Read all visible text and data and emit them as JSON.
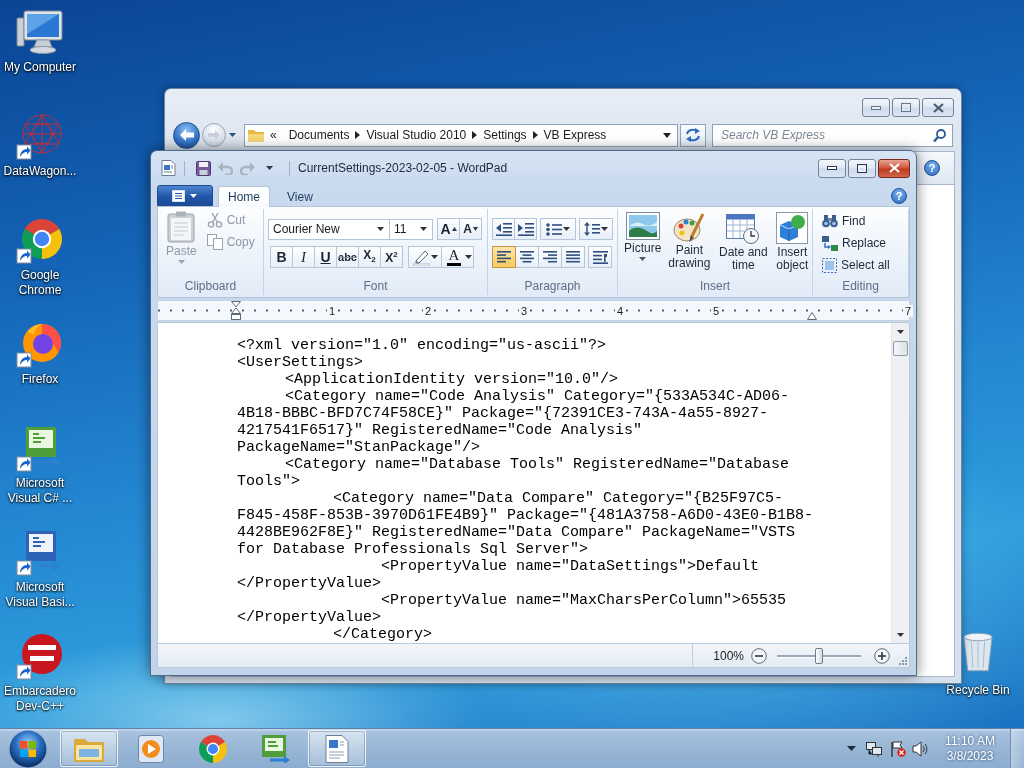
{
  "desktop": {
    "icons": [
      {
        "kind": "computer",
        "label": "My Computer",
        "shortcut": false
      },
      {
        "kind": "network",
        "label": "DataWagon...",
        "shortcut": true
      },
      {
        "kind": "chrome",
        "label": "Google Chrome",
        "shortcut": true
      },
      {
        "kind": "firefox",
        "label": "Firefox",
        "shortcut": true
      },
      {
        "kind": "csharp",
        "label": "Microsoft Visual C# ...",
        "shortcut": true
      },
      {
        "kind": "vb",
        "label": "Microsoft Visual Basi...",
        "shortcut": true
      },
      {
        "kind": "devcpp",
        "label": "Embarcadero Dev-C++",
        "shortcut": true
      }
    ],
    "recycle_bin": {
      "label": "Recycle Bin"
    }
  },
  "explorer": {
    "active": false,
    "nav": [
      {
        "kind": "back",
        "disabled": false
      },
      {
        "kind": "forward",
        "disabled": true
      }
    ],
    "address": {
      "overflow": "«",
      "crumbs": [
        "Documents",
        "Visual Studio 2010",
        "Settings",
        "VB Express"
      ]
    },
    "search": {
      "placeholder": "Search VB Express"
    },
    "help": "?"
  },
  "wordpad": {
    "active": true,
    "quick_access": [
      {
        "kind": "save",
        "disabled": false
      },
      {
        "kind": "undo",
        "disabled": true
      },
      {
        "kind": "redo",
        "disabled": true
      }
    ],
    "title": "CurrentSettings-2023-02-05 - WordPad",
    "tabs": [
      {
        "label": "Home",
        "selected": true
      },
      {
        "label": "View",
        "selected": false
      }
    ],
    "help": "?",
    "ribbon": {
      "clipboard": {
        "label": "Clipboard",
        "paste": {
          "label": "Paste",
          "disabled": true
        },
        "cut": {
          "label": "Cut",
          "disabled": true
        },
        "copy": {
          "label": "Copy",
          "disabled": true
        }
      },
      "font": {
        "label": "Font",
        "family": "Courier New",
        "size": "11",
        "grow": "A",
        "shrink": "A",
        "styles": [
          {
            "kind": "bold",
            "label": "B"
          },
          {
            "kind": "italic",
            "label": "I"
          },
          {
            "kind": "underline",
            "label": "U"
          },
          {
            "kind": "strike",
            "label": "abc"
          },
          {
            "kind": "sub",
            "label": "X$_{2}$"
          },
          {
            "kind": "sup",
            "label": "X$^{2}$"
          }
        ],
        "swatch_button": {
          "label": "A"
        }
      },
      "paragraph": {
        "label": "Paragraph",
        "alignments": [
          {
            "kind": "left",
            "selected": true
          },
          {
            "kind": "center",
            "selected": false
          },
          {
            "kind": "right",
            "selected": false
          },
          {
            "kind": "justify",
            "selected": false
          }
        ]
      },
      "insert": {
        "label": "Insert",
        "items": [
          {
            "kind": "picture",
            "label": "Picture",
            "menu": true
          },
          {
            "kind": "paint",
            "label": "Paint drawing",
            "menu": false
          },
          {
            "kind": "datetime",
            "label": "Date and time",
            "menu": false
          },
          {
            "kind": "object",
            "label": "Insert object",
            "menu": false
          }
        ]
      },
      "editing": {
        "label": "Editing",
        "items": [
          {
            "kind": "find",
            "label": "Find"
          },
          {
            "kind": "replace",
            "label": "Replace"
          },
          {
            "kind": "select",
            "label": "Select all"
          }
        ]
      }
    },
    "ruler": {
      "marks": [
        {
          "kind": "number",
          "label": "1"
        },
        {
          "kind": "number",
          "label": "2"
        },
        {
          "kind": "number",
          "label": "3"
        },
        {
          "kind": "number",
          "label": "4"
        },
        {
          "kind": "number",
          "label": "5"
        },
        {
          "kind": "right_indent"
        },
        {
          "kind": "number",
          "label": "7"
        }
      ]
    },
    "document": {
      "lines": [
        "<?xml version=\"1.0\" encoding=\"us-ascii\"?>",
        "<UserSettings>",
        "\t<ApplicationIdentity version=\"10.0\"/>",
        "\t<Category name=\"Code Analysis\" Category=\"{533A534C-AD06-",
        "4B18-BBBC-BFD7C74F58CE}\" Package=\"{72391CE3-743A-4a55-8927-",
        "4217541F6517}\" RegisteredName=\"Code Analysis\"",
        "PackageName=\"StanPackage\"/>",
        "\t<Category name=\"Database Tools\" RegisteredName=\"Database",
        "Tools\">",
        "\t\t<Category name=\"Data Compare\" Category=\"{B25F97C5-",
        "F845-458F-853B-3970D61FE4B9}\" Package=\"{481A3758-A6D0-43E0-B1B8-",
        "4428BE962F8E}\" RegisteredName=\"Data Compare\" PackageName=\"VSTS",
        "for Database Professionals Sql Server\">",
        "\t\t\t<PropertyValue name=\"DataSettings\">Default",
        "</PropertyValue>",
        "\t\t\t<PropertyValue name=\"MaxCharsPerColumn\">65535",
        "</PropertyValue>",
        "\t\t</Category>"
      ]
    },
    "status_bar": {
      "zoom": "100%",
      "zoom_slider": {
        "level": 0.5
      }
    }
  },
  "taskbar": {
    "buttons": [
      {
        "kind": "folder",
        "open": true
      },
      {
        "kind": "media",
        "open": false
      },
      {
        "kind": "chrome",
        "open": false
      },
      {
        "kind": "csharp",
        "open": false
      },
      {
        "kind": "wordpad",
        "open": true
      }
    ],
    "clock": {
      "time": "11:10 AM",
      "date": "3/8/2023"
    }
  }
}
